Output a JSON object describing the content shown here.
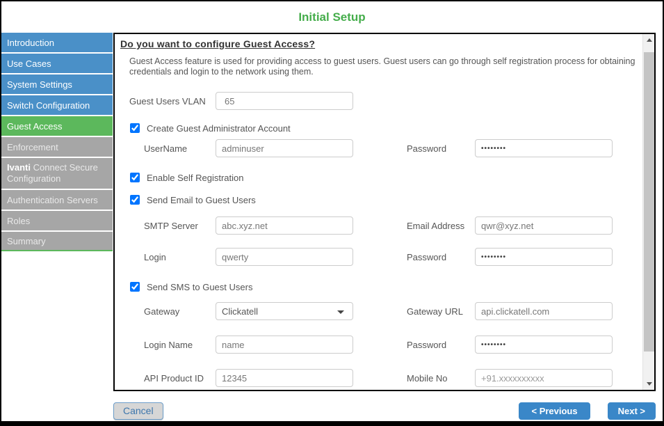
{
  "title": "Initial Setup",
  "colors": {
    "title_green": "#45ad4b",
    "step_done_blue": "#4a90c8",
    "step_active_green": "#5cb85c",
    "step_pending_gray": "#a6a6a6",
    "button_blue": "#3a87c8"
  },
  "sidebar": {
    "items": [
      {
        "label": "Introduction",
        "state": "done"
      },
      {
        "label": "Use Cases",
        "state": "done"
      },
      {
        "label": "System Settings",
        "state": "done"
      },
      {
        "label": "Switch Configuration",
        "state": "done"
      },
      {
        "label": "Guest Access",
        "state": "active"
      },
      {
        "label": "Enforcement",
        "state": "pending"
      },
      {
        "label_strong": "Ivanti",
        "label_rest": "Connect Secure",
        "label_rest2": "Configuration",
        "state": "pending"
      },
      {
        "label": "Authentication Servers",
        "state": "pending"
      },
      {
        "label": "Roles",
        "state": "pending"
      },
      {
        "label": "Summary",
        "state": "pending"
      }
    ]
  },
  "content": {
    "heading": "Do you want to configure Guest Access?",
    "description": "Guest Access feature is used for providing access to guest users. Guest users can go through self registration process for obtaining credentials and login to the network using them."
  },
  "form": {
    "vlan": {
      "label": "Guest Users VLAN",
      "value": "65"
    },
    "create_admin": {
      "label": "Create Guest Administrator Account",
      "checked": true
    },
    "username": {
      "label": "UserName",
      "value": "adminuser"
    },
    "admin_password": {
      "label": "Password",
      "value": "••••••••"
    },
    "self_registration": {
      "label": "Enable Self Registration",
      "checked": true
    },
    "send_email": {
      "label": "Send Email to Guest Users",
      "checked": true
    },
    "smtp_server": {
      "label": "SMTP Server",
      "value": "abc.xyz.net"
    },
    "email_address": {
      "label": "Email Address",
      "value": "qwr@xyz.net"
    },
    "smtp_login": {
      "label": "Login",
      "value": "qwerty"
    },
    "smtp_password": {
      "label": "Password",
      "value": "••••••••"
    },
    "send_sms": {
      "label": "Send SMS to Guest Users",
      "checked": true
    },
    "gateway": {
      "label": "Gateway",
      "value": "Clickatell"
    },
    "gateway_url": {
      "label": "Gateway URL",
      "value": "api.clickatell.com"
    },
    "sms_login": {
      "label": "Login Name",
      "value": "name"
    },
    "sms_password": {
      "label": "Password",
      "value": "••••••••"
    },
    "api_product_id": {
      "label": "API Product ID",
      "value": "12345"
    },
    "mobile_no": {
      "label": "Mobile No",
      "placeholder": "+91.xxxxxxxxxx"
    }
  },
  "footer": {
    "cancel_label": "Cancel",
    "previous_label": "< Previous",
    "next_label": "Next >"
  }
}
